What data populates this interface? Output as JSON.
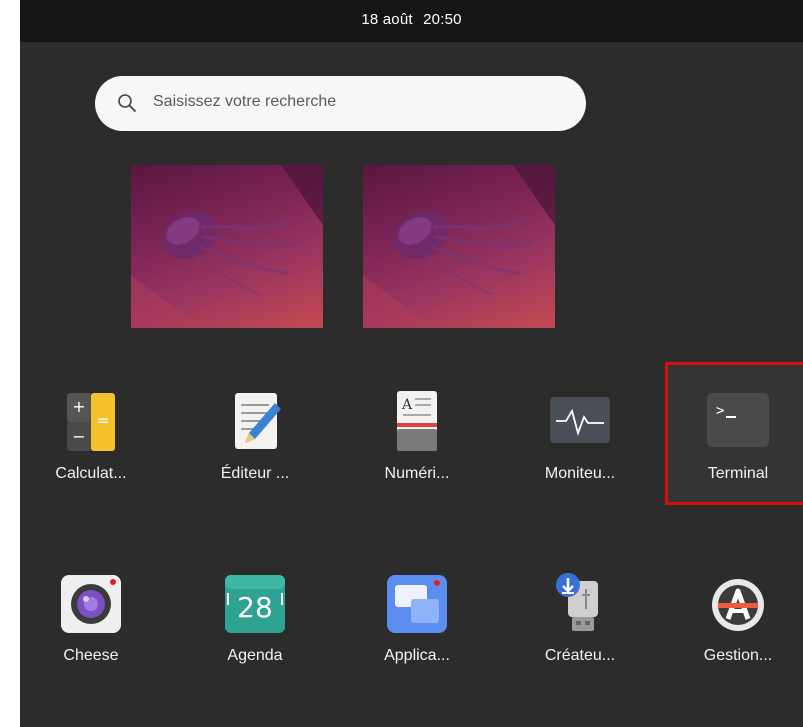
{
  "topbar": {
    "date": "18 août",
    "time": "20:50"
  },
  "search": {
    "placeholder": "Saisissez votre recherche",
    "icon": "search-icon"
  },
  "workspaces": [
    {
      "name": "workspace-1"
    },
    {
      "name": "workspace-2"
    }
  ],
  "apps_row1": [
    {
      "label": "Calculat...",
      "icon": "calculator-icon"
    },
    {
      "label": "Éditeur ...",
      "icon": "text-editor-icon"
    },
    {
      "label": "Numéri...",
      "icon": "document-scanner-icon"
    },
    {
      "label": "Moniteu...",
      "icon": "system-monitor-icon"
    },
    {
      "label": "Terminal",
      "icon": "terminal-icon",
      "highlighted": true
    }
  ],
  "apps_row2": [
    {
      "label": "Cheese",
      "icon": "cheese-camera-icon"
    },
    {
      "label": "Agenda",
      "icon": "calendar-icon",
      "icon_text": "28"
    },
    {
      "label": "Applica...",
      "icon": "applications-icon"
    },
    {
      "label": "Créateu...",
      "icon": "usb-creator-icon"
    },
    {
      "label": "Gestion...",
      "icon": "software-manager-icon"
    }
  ],
  "colors": {
    "highlight": "#d40f0f",
    "background": "#2c2c2c",
    "topbar": "#151515"
  }
}
